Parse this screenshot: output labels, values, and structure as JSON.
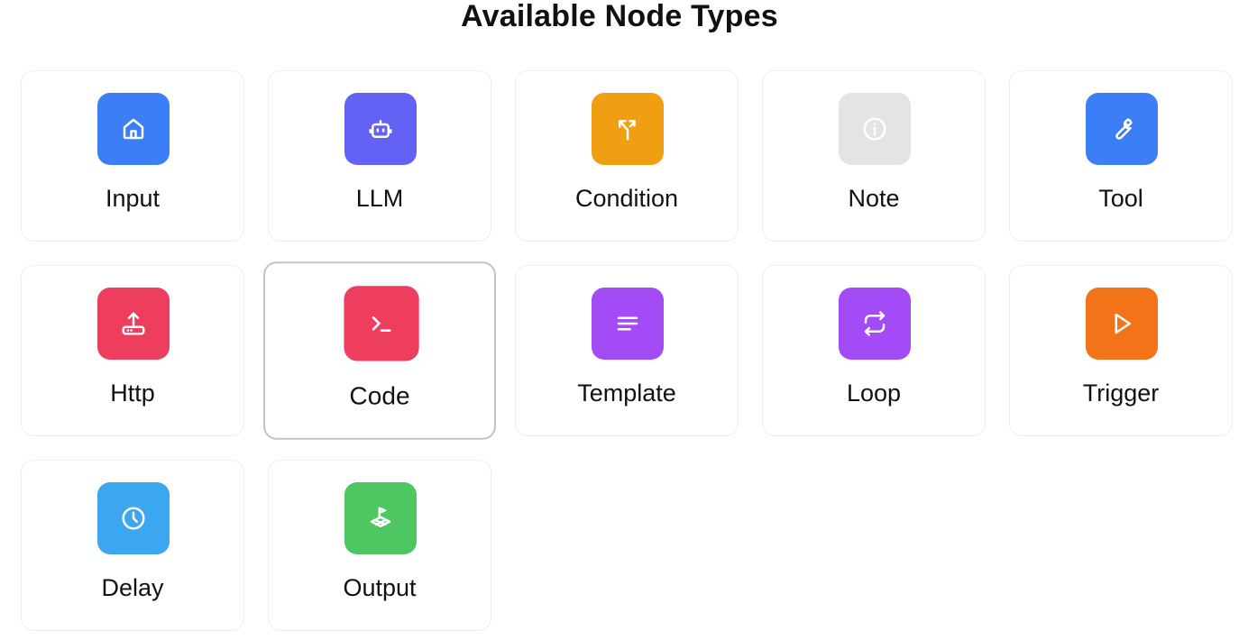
{
  "page": {
    "title": "Available Node Types"
  },
  "nodes": [
    {
      "label": "Input",
      "icon": "home-icon",
      "color": "#3b7ef6"
    },
    {
      "label": "LLM",
      "icon": "bot-icon",
      "color": "#6462f5"
    },
    {
      "label": "Condition",
      "icon": "split-icon",
      "color": "#f09e12"
    },
    {
      "label": "Note",
      "icon": "info-icon",
      "color": "#e4e4e6"
    },
    {
      "label": "Tool",
      "icon": "wrench-icon",
      "color": "#3b7ef6"
    },
    {
      "label": "Http",
      "icon": "upload-icon",
      "color": "#ed3f5d"
    },
    {
      "label": "Code",
      "icon": "terminal-icon",
      "color": "#ed3f5d",
      "selected": true
    },
    {
      "label": "Template",
      "icon": "text-lines-icon",
      "color": "#a34bf7"
    },
    {
      "label": "Loop",
      "icon": "repeat-icon",
      "color": "#a34bf7"
    },
    {
      "label": "Trigger",
      "icon": "play-icon",
      "color": "#f27318"
    },
    {
      "label": "Delay",
      "icon": "clock-icon",
      "color": "#3ca6f1"
    },
    {
      "label": "Output",
      "icon": "flag-icon",
      "color": "#4ec762"
    }
  ]
}
